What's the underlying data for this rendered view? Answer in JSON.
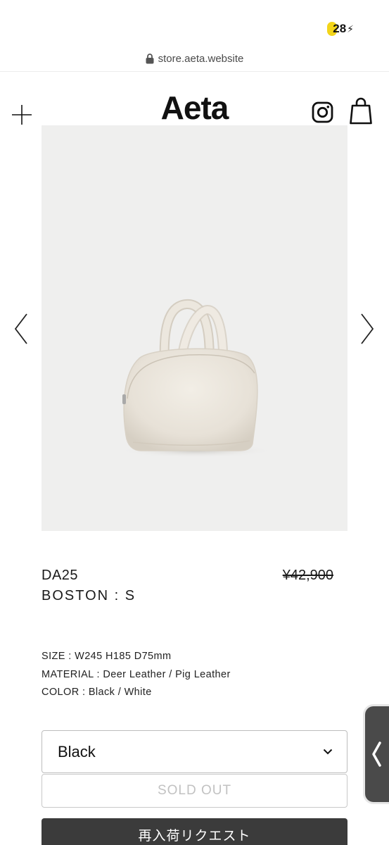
{
  "status_bar": {
    "battery": "28"
  },
  "browser": {
    "url": "store.aeta.website"
  },
  "header": {
    "logo": "Aeta"
  },
  "product": {
    "code": "DA25",
    "name": "BOSTON : S",
    "price": "¥42,900",
    "specs": [
      "SIZE : W245 H185 D75mm",
      "MATERIAL : Deer Leather / Pig Leather",
      "COLOR : Black / White"
    ],
    "selected_color": "Black",
    "sold_out_label": "SOLD OUT",
    "restock_label": "再入荷リクエスト"
  },
  "icons": {
    "menu": "plus-icon",
    "instagram": "instagram-icon",
    "cart": "shopping-bag-icon",
    "prev": "chevron-left-icon",
    "next": "chevron-right-icon",
    "select": "chevron-down-icon",
    "lock": "lock-icon"
  },
  "colors": {
    "accent_dark": "#3b3b3b",
    "battery_yellow": "#f3d51a",
    "image_bg": "#efefee"
  }
}
